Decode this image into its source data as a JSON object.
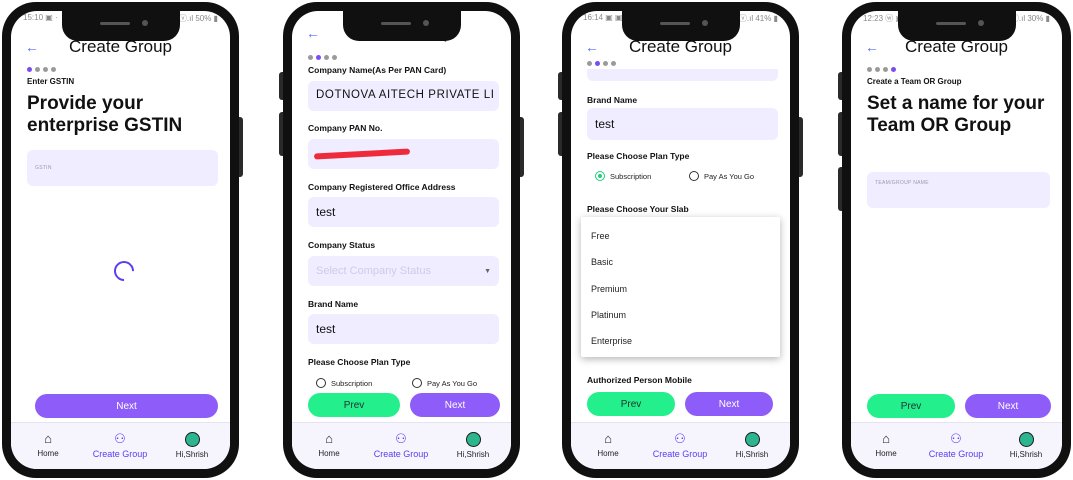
{
  "app": {
    "title": "Create Group",
    "back_icon": "←",
    "next_label": "Next",
    "prev_label": "Prev",
    "accent": "#8e5cf8",
    "prev_color": "#23ef8c"
  },
  "nav": {
    "home": "Home",
    "create_group": "Create Group",
    "profile": "Hi,Shrish"
  },
  "screen1": {
    "status_left": "15:10 ▣ ·",
    "status_right": "ⓥ.ıl 50% ▮",
    "step_label": "Enter GSTIN",
    "headline": "Provide your enterprise GSTIN",
    "gstin_placeholder": "GSTIN"
  },
  "screen2": {
    "company_name_label": "Company Name(As Per PAN Card)",
    "company_name_value": "DOTNOVA AITECH PRIVATE LIMITED",
    "pan_label": "Company PAN No.",
    "address_label": "Company Registered Office Address",
    "address_value": "test",
    "status_label": "Company Status",
    "status_placeholder": "Select Company Status",
    "brand_label": "Brand Name",
    "brand_value": "test",
    "plan_label": "Please Choose Plan Type",
    "plan_options": [
      "Subscription",
      "Pay As You Go"
    ]
  },
  "screen3": {
    "status_left": "16:14 ▣ ▣ ·",
    "status_right": "ⓥ.ıl 41% ▮",
    "brand_label": "Brand Name",
    "brand_value": "test",
    "plan_label": "Please Choose Plan Type",
    "plan_options": [
      "Subscription",
      "Pay As You Go"
    ],
    "slab_label": "Please Choose Your Slab",
    "slab_options": [
      "Free",
      "Basic",
      "Premium",
      "Platinum",
      "Enterprise"
    ],
    "mobile_label": "Authorized Person Mobile"
  },
  "screen4": {
    "status_left": "12:23 ⓦ ▣ ·",
    "status_right": "ⓥ.ıl 30% ▮",
    "step_label": "Create a Team OR Group",
    "headline": "Set a name for your Team OR Group",
    "name_placeholder": "TEAM/GROUP NAME"
  }
}
